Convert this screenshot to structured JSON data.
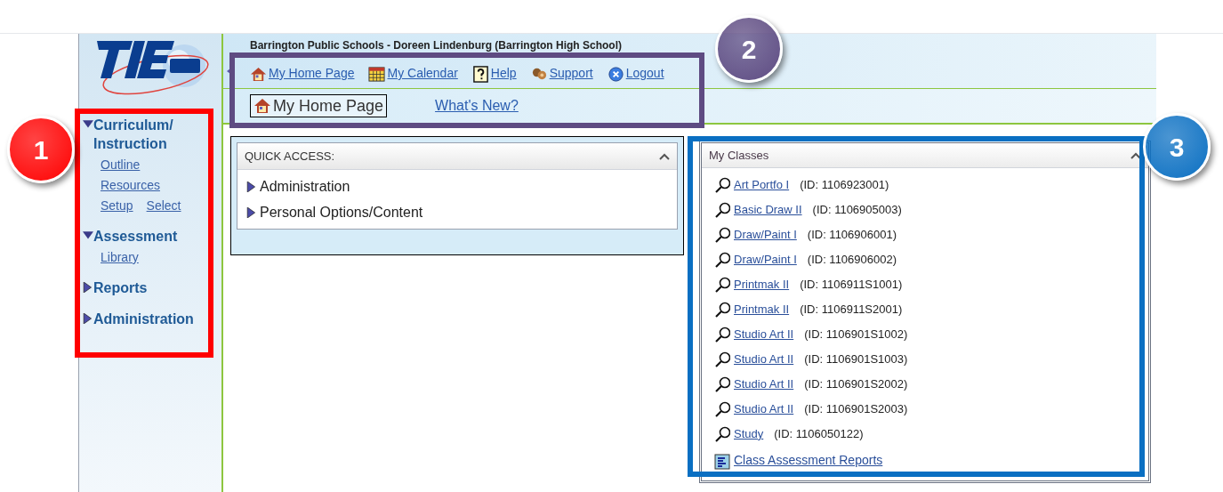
{
  "header": {
    "school_line": "Barrington Public Schools - Doreen Lindenburg (Barrington High School)",
    "nav_links": [
      "My Home Page",
      "My Calendar",
      "Help",
      "Support",
      "Logout"
    ],
    "page_title": "My Home Page",
    "whats_new": "What's New?"
  },
  "sidebar": {
    "sections": [
      {
        "label": "Curriculum/ Instruction",
        "expanded": true,
        "link_rows": [
          [
            "Outline"
          ],
          [
            "Resources"
          ],
          [
            "Setup",
            "Select"
          ]
        ]
      },
      {
        "label": "Assessment",
        "expanded": true,
        "link_rows": [
          [
            "Library"
          ]
        ]
      },
      {
        "label": "Reports",
        "expanded": false
      },
      {
        "label": "Administration",
        "expanded": false
      }
    ]
  },
  "quick_access": {
    "title": "QUICK ACCESS:",
    "items": [
      {
        "label": "Administration",
        "expanded": false
      },
      {
        "label": "Personal Options/Content",
        "expanded": false
      }
    ]
  },
  "my_classes": {
    "title": "My Classes",
    "classes": [
      {
        "name": "Art Portfo I",
        "id": "(ID: 1106923001)"
      },
      {
        "name": "Basic Draw II",
        "id": "(ID: 1106905003)"
      },
      {
        "name": "Draw/Paint I",
        "id": "(ID: 1106906001)"
      },
      {
        "name": "Draw/Paint I",
        "id": "(ID: 1106906002)"
      },
      {
        "name": "Printmak II",
        "id": "(ID: 1106911S1001)"
      },
      {
        "name": "Printmak II",
        "id": "(ID: 1106911S2001)"
      },
      {
        "name": "Studio Art II",
        "id": "(ID: 1106901S1002)"
      },
      {
        "name": "Studio Art II",
        "id": "(ID: 1106901S1003)"
      },
      {
        "name": "Studio Art II",
        "id": "(ID: 1106901S2002)"
      },
      {
        "name": "Studio Art II",
        "id": "(ID: 1106901S2003)"
      },
      {
        "name": "Study",
        "id": "(ID: 1106050122)"
      }
    ],
    "footer_link": "Class Assessment Reports"
  },
  "callouts": [
    {
      "number": "1",
      "color": "#ff0000"
    },
    {
      "number": "2",
      "color": "#5e4b82"
    },
    {
      "number": "3",
      "color": "#0a6fc2"
    }
  ]
}
